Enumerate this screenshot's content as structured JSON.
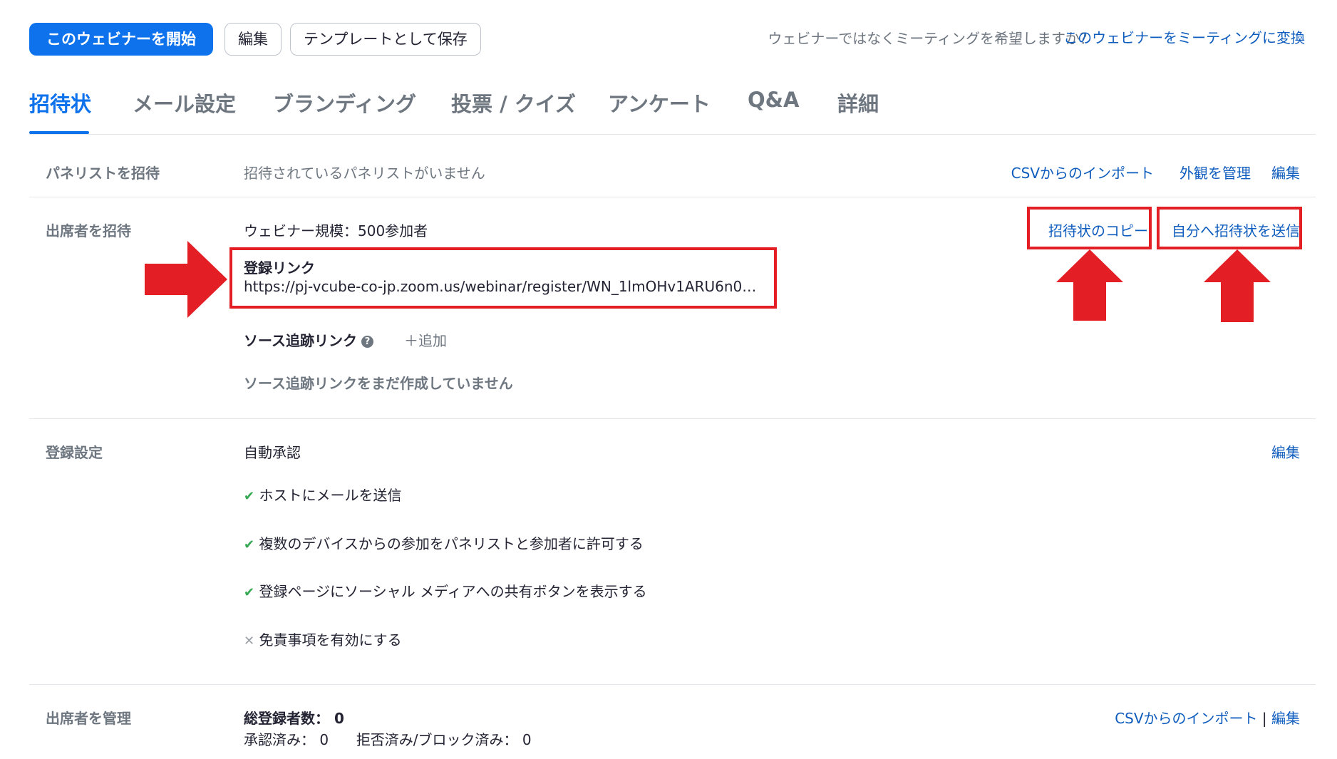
{
  "toolbar": {
    "start_label": "このウェビナーを開始",
    "edit_label": "編集",
    "save_template_label": "テンプレートとして保存",
    "question": "ウェビナーではなくミーティングを希望しますか？",
    "convert_link": "このウェビナーをミーティングに変換"
  },
  "tabs": [
    {
      "label": "招待状"
    },
    {
      "label": "メール設定"
    },
    {
      "label": "ブランディング"
    },
    {
      "label": "投票 / クイズ"
    },
    {
      "label": "アンケート"
    },
    {
      "label": "Q&A"
    },
    {
      "label": "詳細"
    }
  ],
  "panelists": {
    "label": "パネリストを招待",
    "empty": "招待されているパネリストがいません",
    "csv_import": "CSVからのインポート",
    "manage_appearance": "外観を管理",
    "edit": "編集"
  },
  "attendees": {
    "label": "出席者を招待",
    "capacity": "ウェビナー規模：500参加者",
    "reg_link_title": "登録リンク",
    "reg_link_url": "https://pj-vcube-co-jp.zoom.us/webinar/register/WN_1lmOHv1ARU6n0u…",
    "copy_invite": "招待状のコピー",
    "send_to_me": "自分へ招待状を送信",
    "source_tracking_label": "ソース追跡リンク",
    "add": "＋追加",
    "source_empty": "ソース追跡リンクをまだ作成していません"
  },
  "registration": {
    "label": "登録設定",
    "auto_approve": "自動承認",
    "edit": "編集",
    "options": [
      {
        "text": "ホストにメールを送信",
        "enabled": true
      },
      {
        "text": "複数のデバイスからの参加をパネリストと参加者に許可する",
        "enabled": true
      },
      {
        "text": "登録ページにソーシャル メディアへの共有ボタンを表示する",
        "enabled": true
      },
      {
        "text": "免責事項を有効にする",
        "enabled": false
      }
    ]
  },
  "manage": {
    "label": "出席者を管理",
    "total_label": "総登録者数：",
    "total_value": "0",
    "approved_label": "承認済み：",
    "approved_value": "0",
    "rejected_label": "拒否済み/ブロック済み：",
    "rejected_value": "0",
    "csv_import": "CSVからのインポート",
    "separator": "|",
    "edit": "編集"
  },
  "colors": {
    "primary": "#0e72ed",
    "link": "#0e5cbd",
    "annotation_red": "#e31e25",
    "check_green": "#34a853"
  }
}
